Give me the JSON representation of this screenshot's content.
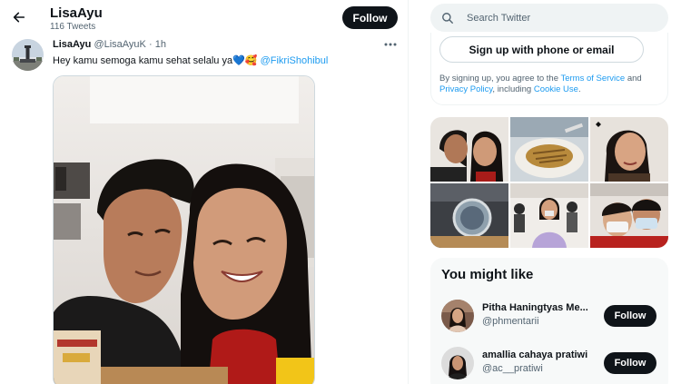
{
  "header": {
    "title": "LisaAyu",
    "tweet_count": "116 Tweets",
    "follow_label": "Follow"
  },
  "tweet": {
    "display_name": "LisaAyu",
    "handle": "@LisaAyuK",
    "separator": "·",
    "time": "1h",
    "text": "Hey kamu semoga kamu sehat selalu ya",
    "emoji_1": "💙",
    "emoji_2": "🥰",
    "mention": "@FikriShohibul"
  },
  "sidebar": {
    "search": {
      "placeholder": "Search Twitter"
    },
    "signup": {
      "button_label": "Sign up with phone or email",
      "terms_prefix": "By signing up, you agree to the",
      "terms_link": "Terms of Service",
      "terms_and": "and",
      "privacy_link": "Privacy Policy",
      "including": ", including",
      "cookie_link": "Cookie Use",
      "period": "."
    },
    "you_might_like": {
      "title": "You might like",
      "accounts": [
        {
          "name": "Pitha Haningtyas Me...",
          "handle": "@phmentarii",
          "follow_label": "Follow"
        },
        {
          "name": "amallia cahaya pratiwi",
          "handle": "@ac__pratiwi",
          "follow_label": "Follow"
        }
      ]
    }
  },
  "colors": {
    "accent": "#1d9bf0",
    "text_primary": "#0f1419",
    "text_secondary": "#536471",
    "button_dark": "#0f1419",
    "search_bg": "#eff3f4",
    "panel_bg": "#f7f9f9"
  },
  "icons": {
    "back": "arrow-left-icon",
    "more": "more-horizontal-icon",
    "search": "search-icon"
  }
}
